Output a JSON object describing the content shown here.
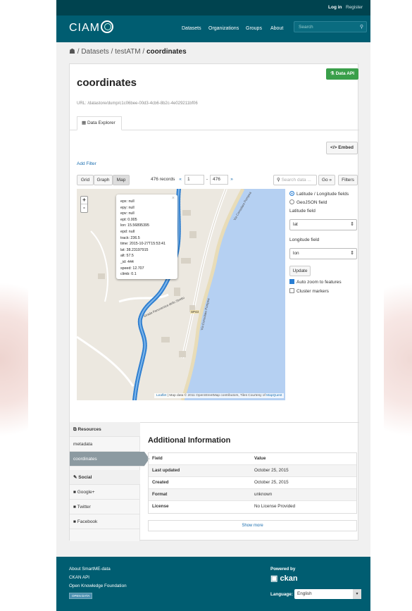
{
  "account": {
    "login": "Log in",
    "register": "Register"
  },
  "site": {
    "logo": "CIAM"
  },
  "nav": {
    "datasets": "Datasets",
    "organizations": "Organizations",
    "groups": "Groups",
    "about": "About",
    "search_placeholder": "Search"
  },
  "breadcrumb": {
    "sep1": "/",
    "datasets": "Datasets",
    "sep2": "/",
    "dataset": "testATM",
    "sep3": "/",
    "current": "coordinates"
  },
  "resource": {
    "api_button": "Data API",
    "title": "coordinates",
    "url": "URL: /datastore/dump/c1c06bee-00d3-4cb6-8b2c-4e029211bf06",
    "tab": "Data Explorer",
    "embed": "Embed"
  },
  "explorer": {
    "add_filter": "Add Filter",
    "views": [
      "Grid",
      "Graph",
      "Map"
    ],
    "records": "476 records",
    "prev": "«",
    "from": "1",
    "dash": "-",
    "to": "476",
    "next": "»",
    "search_placeholder": "Search data ...",
    "go": "Go »",
    "filters": "Filters"
  },
  "popup": {
    "lines": [
      "epx: null",
      "epy: null",
      "epv: null",
      "ept: 0.005",
      "lon: 15.56895395",
      "epd: null",
      "track: 236.5",
      "time: 2015-10-27T15:53:41",
      "lat: 38.23197915",
      "alt: 57.5",
      "_id: 444",
      "speed: 12.707",
      "climb: 0.1"
    ]
  },
  "map": {
    "zoom_in": "+",
    "zoom_out": "-",
    "road_label": "SP43",
    "road_label2": "Strada Panoramica dello Stretto",
    "road_label3": "Via Consolare Pompea",
    "road_label4": "Via Consolare Pompea",
    "attribution_leaflet": "Leaflet",
    "attribution_text": "| Map data © 2011 OpenStreetMap contributors, Tiles Courtesy of",
    "attribution_mq": "MapQuest"
  },
  "map_settings": {
    "radio_latlon": "Latitude / Longitude fields",
    "radio_geojson": "GeoJSON field",
    "lat_label": "Latitude field",
    "lat_value": "lat",
    "lon_label": "Longitude field",
    "lon_value": "lon",
    "update": "Update",
    "auto_zoom": "Auto zoom to features",
    "cluster": "Cluster markers"
  },
  "sidebar": {
    "resources_head": "Resources",
    "items": [
      "metadata",
      "coordinates"
    ],
    "social_head": "Social",
    "social": [
      "Google+",
      "Twitter",
      "Facebook"
    ]
  },
  "additional": {
    "title": "Additional Information",
    "header": {
      "field": "Field",
      "value": "Value"
    },
    "rows": [
      {
        "field": "Last updated",
        "value": "October 25, 2015"
      },
      {
        "field": "Created",
        "value": "October 25, 2015"
      },
      {
        "field": "Format",
        "value": "unknown"
      },
      {
        "field": "License",
        "value": "No License Provided"
      }
    ],
    "show_more": "Show more"
  },
  "footer": {
    "about": "About SmartME-data",
    "ckan_api": "CKAN API",
    "okf": "Open Knowledge Foundation",
    "badge": "OPEN DATA",
    "powered_by": "Powered by",
    "ckan": "ckan",
    "language_label": "Language:",
    "language": "English"
  }
}
